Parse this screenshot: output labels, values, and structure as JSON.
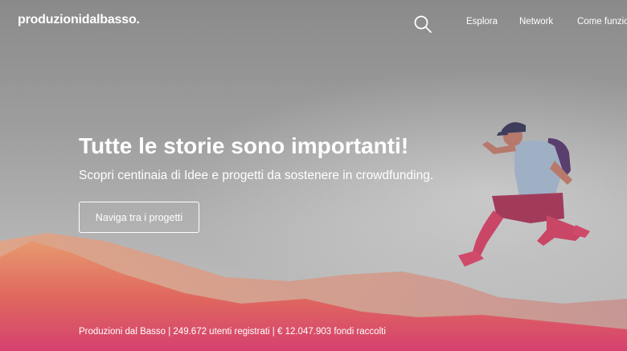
{
  "header": {
    "logo_text": "produzionidalbasso.",
    "search_icon": "search-icon",
    "nav": [
      {
        "label": "Esplora"
      },
      {
        "label": "Network"
      },
      {
        "label": "Come funzio"
      }
    ]
  },
  "hero": {
    "title": "Tutte le storie sono importanti!",
    "subtitle": "Scopri centinaia di Idee e progetti da sostenere in crowdfunding.",
    "cta_label": "Naviga tra i progetti",
    "stats": "Produzioni dal Basso | 249.672 utenti registrati | € 12.047.903 fondi raccolti"
  },
  "colors": {
    "text": "#ffffff",
    "accent_pink": "#d5416f",
    "accent_orange": "#ee7a55"
  }
}
